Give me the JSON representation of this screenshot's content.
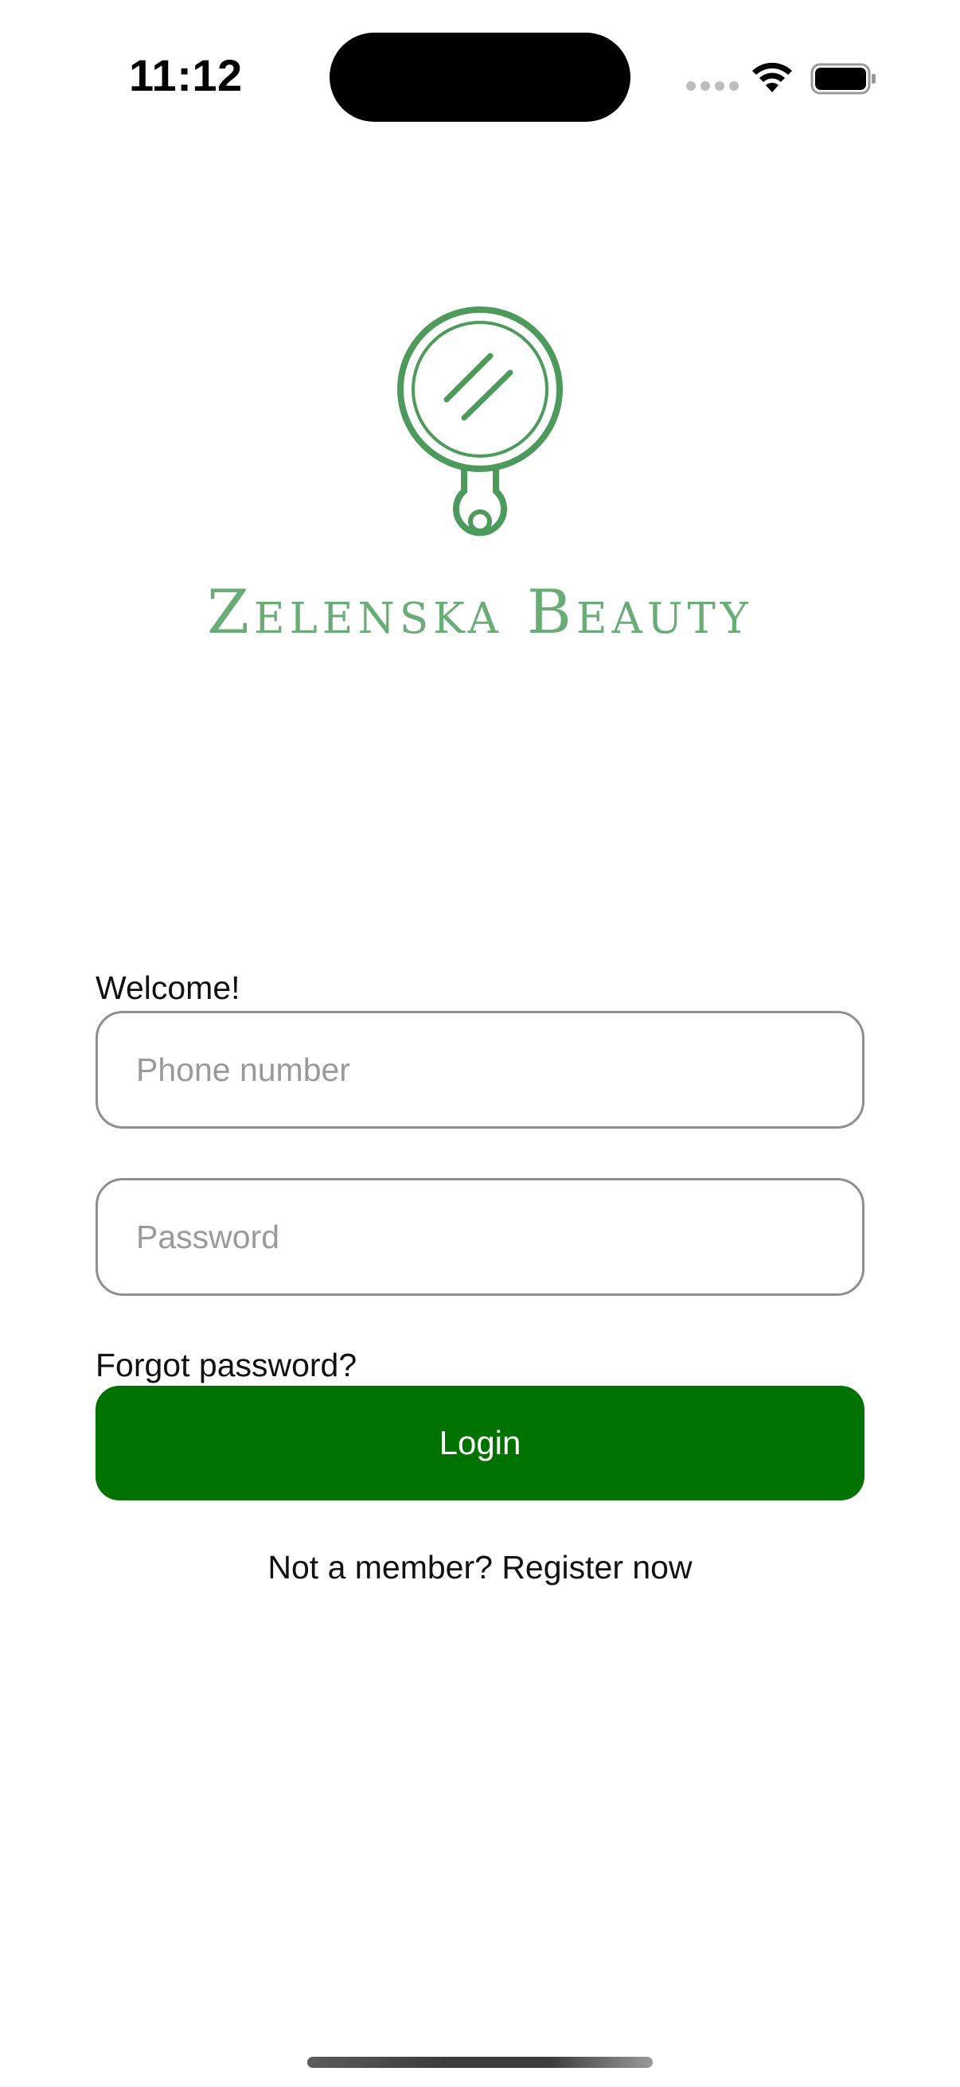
{
  "status_bar": {
    "time": "11:12",
    "icons": [
      "cellular-signal-icon",
      "wifi-icon",
      "battery-icon"
    ]
  },
  "brand": {
    "name": "Zelenska Beauty",
    "logo_icon": "hand-mirror-icon",
    "color": "#6aac76"
  },
  "form": {
    "welcome": "Welcome!",
    "phone_placeholder": "Phone number",
    "phone_value": "",
    "password_placeholder": "Password",
    "password_value": "",
    "forgot_label": "Forgot password?",
    "login_label": "Login",
    "login_color": "#007200",
    "register_label": "Not a member? Register now"
  }
}
